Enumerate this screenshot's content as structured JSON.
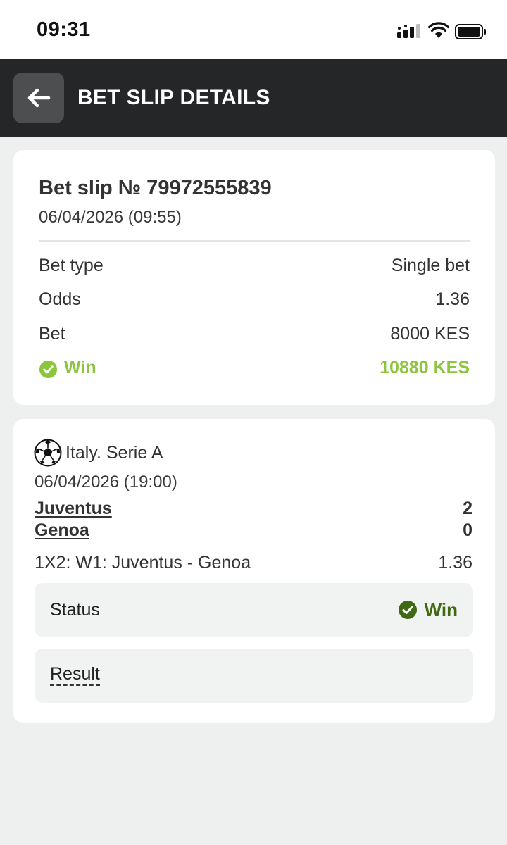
{
  "status_bar": {
    "time": "09:31",
    "icons": [
      "signal-icon",
      "wifi-icon",
      "battery-icon"
    ]
  },
  "header": {
    "title": "BET SLIP DETAILS",
    "back_icon": "arrow-left-icon"
  },
  "summary": {
    "slip_title": "Bet slip № 79972555839",
    "date": "06/04/2026 (09:55)",
    "bet_type_label": "Bet type",
    "bet_type_value": "Single bet",
    "odds_label": "Odds",
    "odds_value": "1.36",
    "bet_label": "Bet",
    "bet_value": "8000 KES",
    "win_label": "Win",
    "win_value": "10880 KES"
  },
  "event": {
    "sport_icon": "soccer-ball-icon",
    "league": "Italy. Serie A",
    "date": "06/04/2026 (19:00)",
    "home_team": "Juventus",
    "away_team": "Genoa",
    "home_score": "2",
    "away_score": "0",
    "market": "1X2: W1: Juventus - Genoa",
    "market_odds": "1.36",
    "status_label": "Status",
    "status_value": "Win",
    "result_label": "Result"
  },
  "colors": {
    "header_bg": "#252627",
    "win_green": "#8cc63f",
    "status_green": "#3f6a12",
    "page_bg": "#eeefef"
  }
}
